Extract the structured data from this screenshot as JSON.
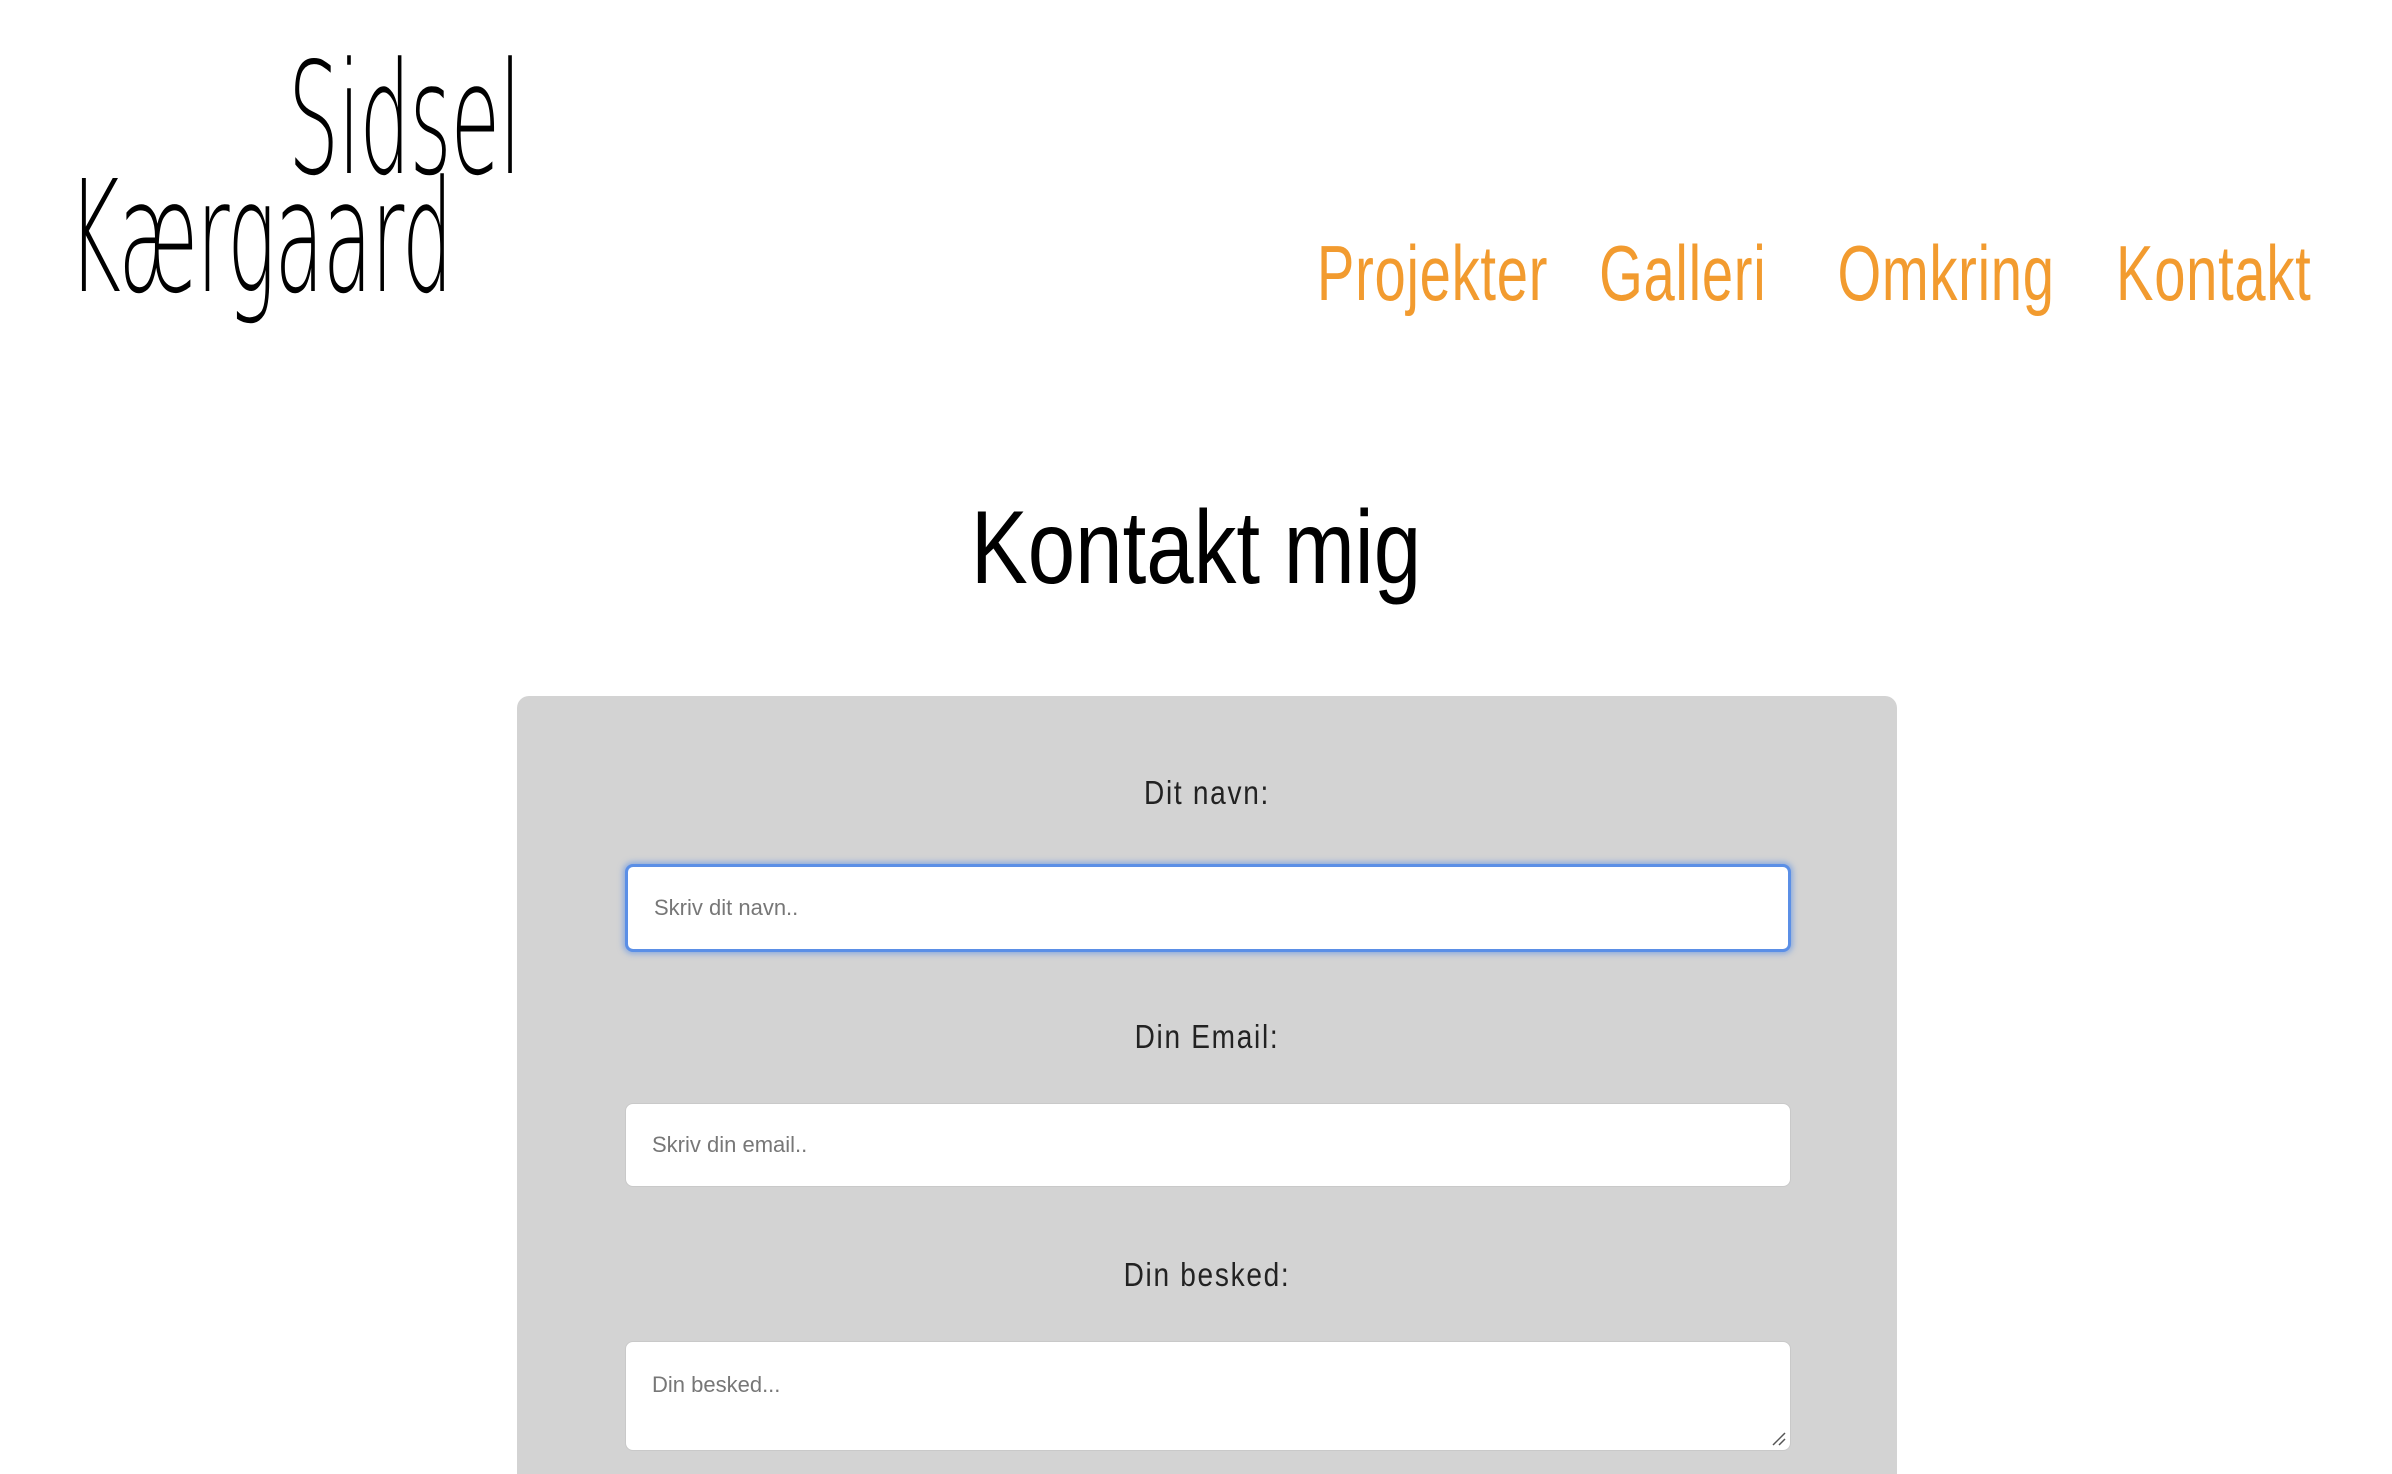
{
  "logo": {
    "line1": "Sidsel",
    "line2": "Kærgaard"
  },
  "nav": {
    "items": [
      {
        "label": "Projekter"
      },
      {
        "label": "Galleri"
      },
      {
        "label": "Omkring"
      },
      {
        "label": "Kontakt"
      }
    ],
    "color": "#f29b2f"
  },
  "page": {
    "title": "Kontakt mig"
  },
  "form": {
    "name_label": "Dit navn:",
    "name_placeholder": "Skriv dit navn..",
    "email_label": "Din Email:",
    "email_placeholder": "Skriv din email..",
    "message_label": "Din besked:",
    "message_placeholder": "Din besked...",
    "card_color": "#d3d3d3",
    "focus_color": "#5b8fe6"
  }
}
